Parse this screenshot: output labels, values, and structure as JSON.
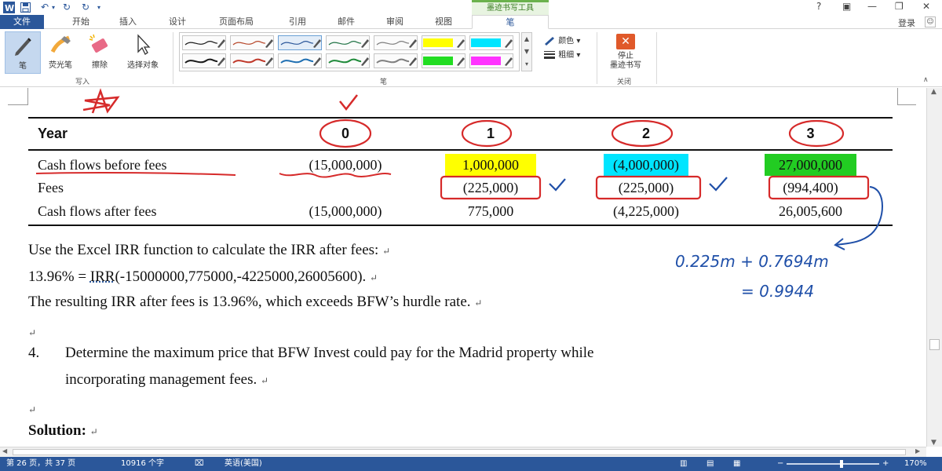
{
  "quick_access": {
    "undo_icon": "undo-icon",
    "redo_icon": "redo-icon",
    "save_icon": "save-icon"
  },
  "context_tab": {
    "title": "墨迹书写工具"
  },
  "window": {
    "help": "?",
    "minimize": "—",
    "restore": "❐",
    "close": "✕",
    "ribbon_display": "▣"
  },
  "tabs": [
    {
      "label": "文件"
    },
    {
      "label": "开始"
    },
    {
      "label": "插入"
    },
    {
      "label": "设计"
    },
    {
      "label": "页面布局"
    },
    {
      "label": "引用"
    },
    {
      "label": "邮件"
    },
    {
      "label": "审阅"
    },
    {
      "label": "视图"
    },
    {
      "label": "笔"
    }
  ],
  "login": "登录",
  "ribbon": {
    "write_tools": [
      {
        "label": "笔",
        "icon": "pen-icon"
      },
      {
        "label": "荧光笔",
        "icon": "highlighter-icon"
      },
      {
        "label": "擦除",
        "icon": "eraser-icon"
      },
      {
        "label": "选择对象",
        "icon": "select-cursor-icon"
      }
    ],
    "write_group_label": "写入",
    "pen_group_label": "笔",
    "pen_swatches": [
      {
        "color": "#1a1a1a"
      },
      {
        "color": "#b7472a"
      },
      {
        "color": "#2b579a"
      },
      {
        "color": "#217346"
      },
      {
        "color": "#7f7f7f"
      },
      {
        "color": "#ffff00",
        "highlighter": true
      },
      {
        "color": "#00e5ff",
        "highlighter": true
      },
      {
        "color": "#1a1a1a"
      },
      {
        "color": "#c0392b"
      },
      {
        "color": "#1f6fb2"
      },
      {
        "color": "#1f8a3a"
      },
      {
        "color": "#7f7f7f"
      },
      {
        "color": "#22dd22",
        "highlighter": true
      },
      {
        "color": "#ff33ff",
        "highlighter": true
      }
    ],
    "color_label": "颜色 ▾",
    "thickness_label": "粗细 ▾",
    "stop_label_1": "停止",
    "stop_label_2": "墨迹书写",
    "close_group_label": "关闭"
  },
  "table": {
    "header": [
      "Year",
      "0",
      "1",
      "2",
      "3"
    ],
    "rows": [
      {
        "label": "Cash flows before fees",
        "values": [
          "(15,000,000)",
          "1,000,000",
          "(4,000,000)",
          "27,000,000"
        ]
      },
      {
        "label": "Fees",
        "values": [
          "",
          "(225,000)",
          "(225,000)",
          "(994,400)"
        ]
      },
      {
        "label": "Cash flows after fees",
        "values": [
          "(15,000,000)",
          "775,000",
          "(4,225,000)",
          "26,005,600"
        ]
      }
    ],
    "highlight_colors": [
      "#ffff00",
      "#00e5ff",
      "#22cc22"
    ]
  },
  "body": {
    "line1": "Use the Excel IRR function to calculate the IRR after fees:",
    "line2_prefix": "13.96% = ",
    "line2_func": "IRR",
    "line2_rest": "(-15000000,775000,-4225000,26005600).",
    "line3": "The resulting IRR after fees is 13.96%, which exceeds BFW’s hurdle rate.",
    "q_number": "4.",
    "q_line1": "Determine the maximum price that BFW Invest could pay for the Madrid property while",
    "q_line2": "incorporating management fees.",
    "solution": "Solution:",
    "para_mark": "↵"
  },
  "handwriting": {
    "sum_line": "0.225m + 0.7694m",
    "result_line": "= 0.9944"
  },
  "status": {
    "page": "第 26 页，共 37 页",
    "words": "10916 个字",
    "language": "英语(美国)",
    "zoom": "170%"
  },
  "colors": {
    "accent": "#2b579a",
    "ink_red": "#d62a2a",
    "ink_blue": "#1f4fa8"
  }
}
